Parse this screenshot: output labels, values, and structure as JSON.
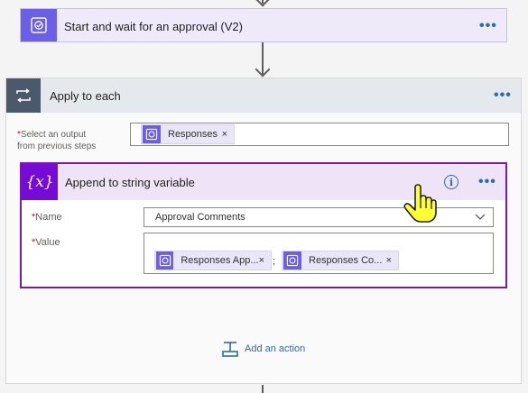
{
  "approval_step": {
    "title": "Start and wait for an approval (V2)",
    "more": "•••"
  },
  "apply_to_each": {
    "title": "Apply to each",
    "more": "•••",
    "select_label_line1": "Select an output",
    "select_label_line2": "from previous steps",
    "required_mark": "*",
    "token": {
      "label": "Responses",
      "remove": "×"
    }
  },
  "append_step": {
    "icon_text": "{x}",
    "title": "Append to string variable",
    "info": "i",
    "more": "•••",
    "name_label": "Name",
    "name_value": "Approval Comments",
    "value_label": "Value",
    "required_mark": "*",
    "value_tokens": [
      {
        "label": "Responses App...",
        "remove": "×"
      },
      {
        "label": "Responses Co...",
        "remove": "×"
      }
    ],
    "separator": ";"
  },
  "add_action": {
    "label": "Add an action"
  },
  "colors": {
    "approval_icon_bg": "#6b5fe8",
    "variable_icon_bg": "#770bd6",
    "accent_blue": "#2b6cb0",
    "foreach_icon_bg": "#4a5a6b"
  }
}
